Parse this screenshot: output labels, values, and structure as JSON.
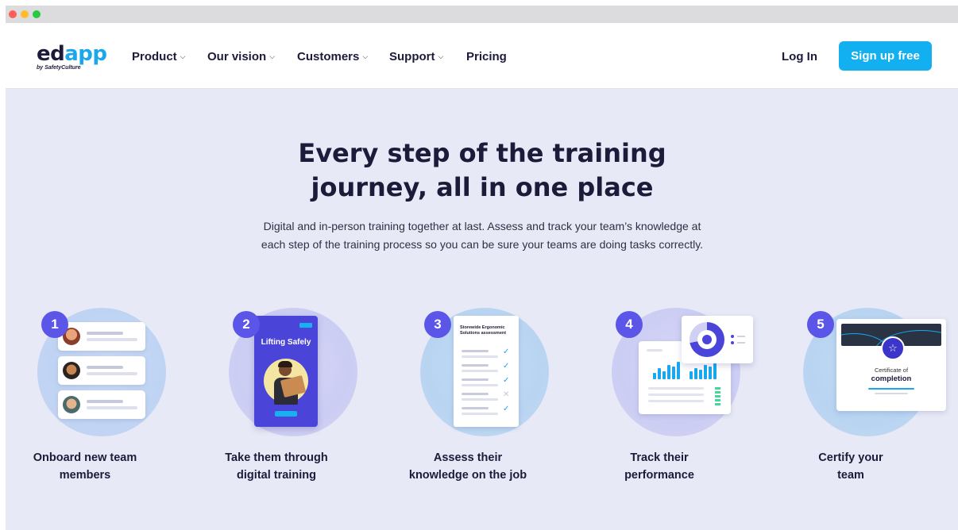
{
  "window": {
    "controls": [
      "close",
      "minimize",
      "maximize"
    ]
  },
  "brand": {
    "name_part1": "ed",
    "name_part2": "app",
    "tagline": "by SafetyCulture",
    "accent": "#1aa7ec"
  },
  "nav": {
    "items": [
      {
        "label": "Product",
        "dropdown": true
      },
      {
        "label": "Our vision",
        "dropdown": true
      },
      {
        "label": "Customers",
        "dropdown": true
      },
      {
        "label": "Support",
        "dropdown": true
      },
      {
        "label": "Pricing",
        "dropdown": false
      }
    ],
    "chevron": "⌵",
    "login_label": "Log In",
    "signup_label": "Sign up free",
    "signup_color": "#12b0f0"
  },
  "hero": {
    "headline_line1": "Every step of the training",
    "headline_line2": "journey, all in one place",
    "description": "Digital and in-person training together at last. Assess and track your team’s knowledge at each step of the training process so you can be sure your teams are doing tasks correctly.",
    "background": "#e7e9f6"
  },
  "steps": [
    {
      "number": "1",
      "caption_line1": "Onboard new team",
      "caption_line2": "members",
      "icon": "onboarding-cards-icon"
    },
    {
      "number": "2",
      "caption_line1": "Take them through",
      "caption_line2": "digital training",
      "icon": "mobile-lesson-icon",
      "lesson_title": "Lifting Safely"
    },
    {
      "number": "3",
      "caption_line1": "Assess their",
      "caption_line2": "knowledge on the job",
      "icon": "checklist-icon",
      "checklist_title": "Storewide Ergonomic Solutions assessment",
      "checks": [
        "✓",
        "✓",
        "✓",
        "✕",
        "✓"
      ]
    },
    {
      "number": "4",
      "caption_line1": "Track their",
      "caption_line2": "performance",
      "icon": "analytics-chart-icon"
    },
    {
      "number": "5",
      "caption_line1": "Certify your",
      "caption_line2": "team",
      "icon": "certificate-icon",
      "cert_line1": "Certificate of",
      "cert_line2": "completion",
      "medal": "☆"
    }
  ],
  "step_badge_color": "#5b55e8"
}
